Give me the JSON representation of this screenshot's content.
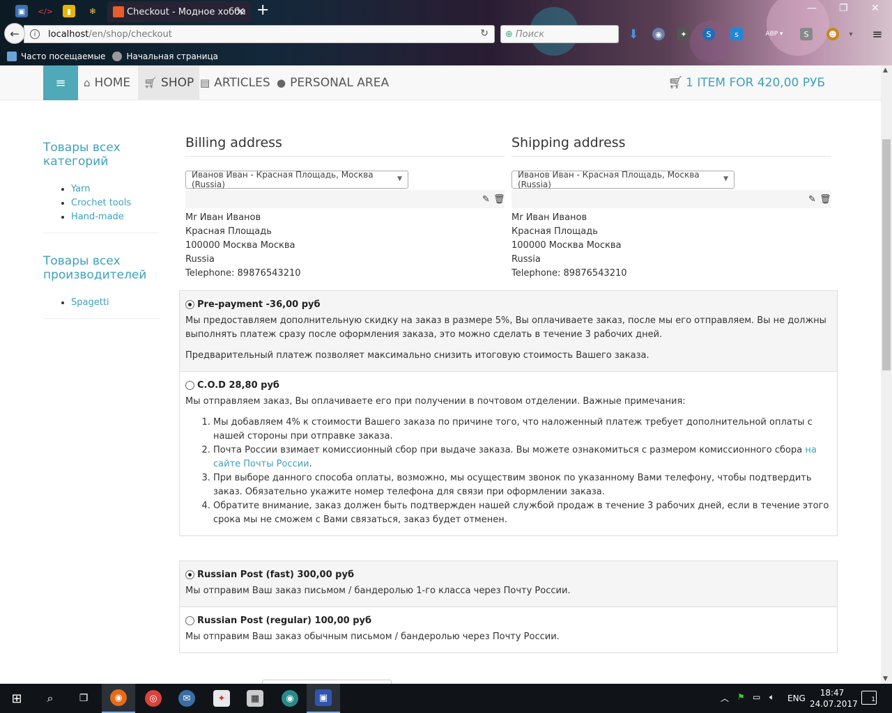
{
  "browser": {
    "active_tab_title": "Checkout - Модное хобби",
    "url_host": "localhost",
    "url_path": "/en/shop/checkout",
    "search_placeholder": "Поиск",
    "bookmarks": [
      {
        "label": "Часто посещаемые"
      },
      {
        "label": "Начальная страница"
      }
    ]
  },
  "site": {
    "menu": [
      {
        "label": "HOME",
        "icon": "home-icon"
      },
      {
        "label": "SHOP",
        "icon": "cart-icon"
      },
      {
        "label": "ARTICLES",
        "icon": "file-icon"
      },
      {
        "label": "PERSONAL AREA",
        "icon": "user-icon"
      }
    ],
    "cart_label": "1 ITEM FOR 420,00 РУБ"
  },
  "sidebar": {
    "categories_title": "Товары всех категорий",
    "categories": [
      "Yarn",
      "Crochet tools",
      "Hand-made"
    ],
    "manufacturers_title": "Товары всех производителей",
    "manufacturers": [
      "Spagetti"
    ]
  },
  "billing": {
    "title": "Billing address",
    "selected": "Иванов Иван - Красная Площадь, Москва (Russia)",
    "lines": [
      "Мr Иван Иванов",
      "Красная Площадь",
      "100000 Москва Москва",
      "Russia",
      "Telephone: 89876543210"
    ]
  },
  "shipping": {
    "title": "Shipping address",
    "selected": "Иванов Иван - Красная Площадь, Москва (Russia)",
    "lines": [
      "Мr Иван Иванов",
      "Красная Площадь",
      "100000 Москва Москва",
      "Russia",
      "Telephone: 89876543210"
    ]
  },
  "payment": {
    "prepay": {
      "label": "Pre-payment -36,00 руб",
      "selected": true,
      "text1": "Мы предоставляем дополнительную скидку на заказ в размере 5%, Вы оплачиваете заказ, после мы его отправляем. Вы не должны выполнять платеж сразу после оформления заказа, это можно сделать в течение 3 рабочих дней.",
      "text2": "Предварительный платеж позволяет максимально снизить итоговую стоимость Вашего заказа."
    },
    "cod": {
      "label": "C.O.D 28,80 руб",
      "selected": false,
      "intro": "Мы отправляем заказ, Вы оплачиваете его при получении в почтовом отделении. Важные примечания:",
      "item1": "Мы добавляем 4% к стоимости Вашего заказа по причине того, что наложенный платеж требует дополнительной оплаты с нашей стороны при отправке заказа.",
      "item2_text": "Почта России взимает комиссионный сбор при выдаче заказа. Вы можете ознакомиться с размером комиссионного сбора ",
      "item2_link": "на сайте Почты России",
      "item3": "При выборе данного способа оплаты, возможно, мы осуществим звонок по указанному Вами телефону, чтобы подтвердить заказ. Обязательно укажите номер телефона для связи при оформлении заказа.",
      "item4": "Обратите внимание, заказ должен быть подтвержден нашей службой продаж в течение 3 рабочих дней, если в течение этого срока мы не сможем с Вами связаться, заказ будет отменен."
    }
  },
  "shipping_methods": {
    "fast": {
      "label": "Russian Post (fast) 300,00 руб",
      "selected": true,
      "text": "Мы отправим Ваш заказ письмом / бандеролью 1-го класса через Почту России."
    },
    "regular": {
      "label": "Russian Post (regular) 100,00 руб",
      "selected": false,
      "text": "Мы отправим Ваш заказ обычным письмом / бандеролью через Почту России."
    }
  },
  "taskbar": {
    "language": "ENG",
    "time": "18:47",
    "date": "24.07.2017",
    "notifications": "1"
  },
  "colors": {
    "accent": "#3ea1b9",
    "hamburger": "#4fa9b8"
  }
}
